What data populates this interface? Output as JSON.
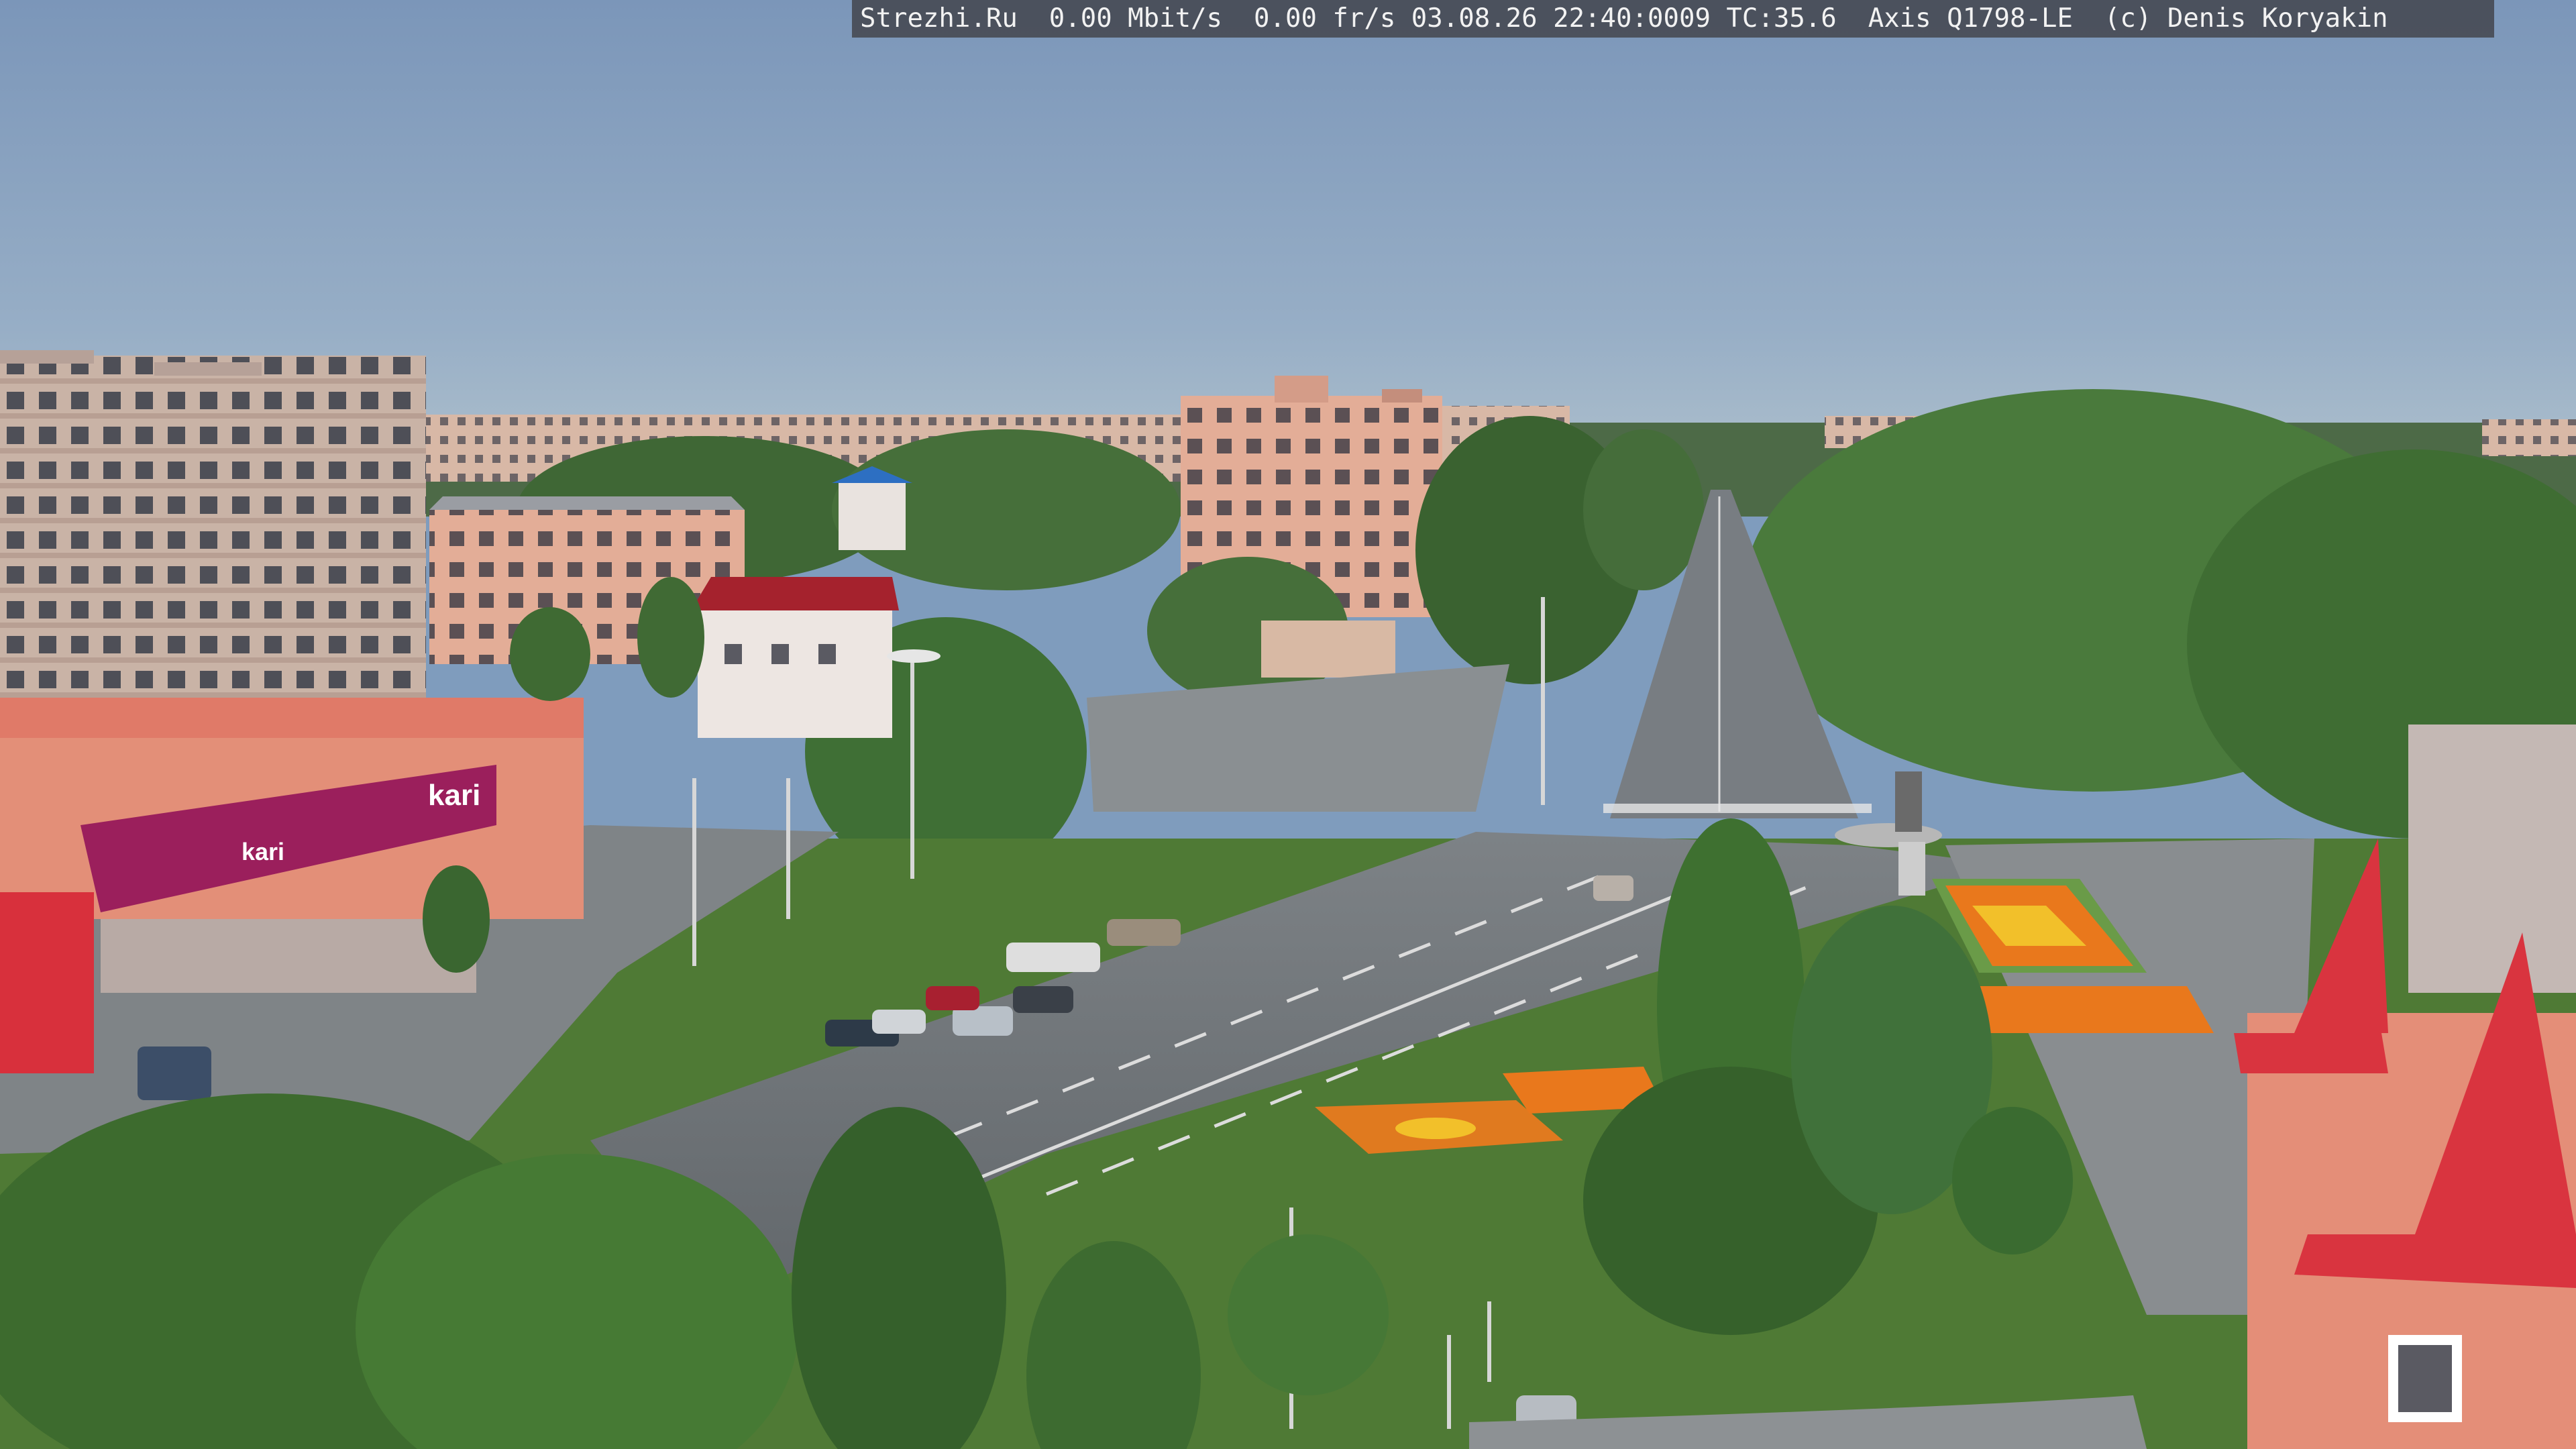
{
  "overlay": {
    "text": "Strezhi.Ru  0.00 Mbit/s  0.00 fr/s 03.08.26 22:40:0009 TC:35.6  Axis Q1798-LE  (c) Denis Koryakin"
  },
  "signage": {
    "store_brand": "kari",
    "store_brand_small": "kari"
  },
  "colors": {
    "sky_top": "#7d98bb",
    "sky_bottom": "#a6b9c6",
    "forest": "#3f6b34",
    "road": "#6f7478",
    "plaza": "#8a8f92",
    "store_banner": "#9b1f5c",
    "roof_red": "#d9343f",
    "flowers_orange": "#e9781c",
    "flowers_yellow": "#f2c02a"
  }
}
